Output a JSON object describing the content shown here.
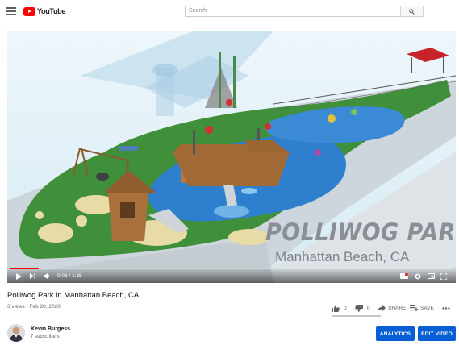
{
  "header": {
    "logo_text": "YouTube",
    "search_placeholder": "Search"
  },
  "player": {
    "overlay_title": "POLLIWOG PARK",
    "overlay_subtitle": "Manhattan Beach, CA",
    "time_current": "0:06",
    "time_total": "1:35",
    "time_display": "0:06 / 1:35",
    "progress_fraction": 0.063
  },
  "video": {
    "title": "Polliwog Park in Manhattan Beach, CA",
    "meta": "3 views • Feb 20, 2020",
    "likes": "0",
    "dislikes": "0",
    "share_label": "SHARE",
    "save_label": "SAVE"
  },
  "channel": {
    "name": "Kevin Burgess",
    "subscribers": "7 subscribers"
  },
  "buttons": {
    "analytics": "ANALYTICS",
    "edit_video": "EDIT VIDEO"
  },
  "colors": {
    "brand_red": "#ff0000",
    "primary_blue": "#065fd4"
  }
}
